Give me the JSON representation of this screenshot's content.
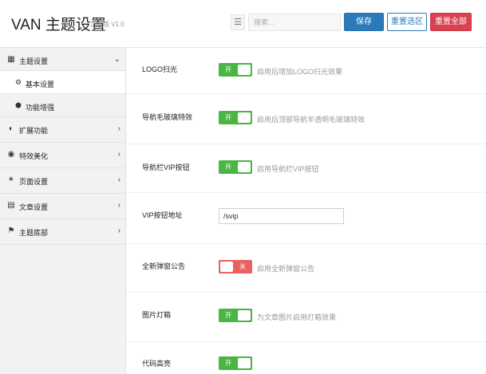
{
  "header": {
    "title": "VAN 主题设置",
    "subtitle": "正式版 V1.0",
    "menu_icon": "☰",
    "search_placeholder": "搜索...",
    "save_label": "保存",
    "reset_section_label": "重置选区",
    "reset_all_label": "重置全部"
  },
  "sidebar": {
    "items": [
      {
        "label": "主题设置",
        "icon": "grid-icon",
        "glyph": "▦",
        "expanded": true
      },
      {
        "label": "扩展功能",
        "icon": "circle-notch-icon",
        "glyph": "◐",
        "arrow": "›"
      },
      {
        "label": "特效美化",
        "icon": "palette-icon",
        "glyph": "◉",
        "arrow": "›"
      },
      {
        "label": "页面设置",
        "icon": "star-icon",
        "glyph": "✴",
        "arrow": "›"
      },
      {
        "label": "文章设置",
        "icon": "file-icon",
        "glyph": "▤",
        "arrow": "›"
      },
      {
        "label": "主题底部",
        "icon": "bookmark-icon",
        "glyph": "⚑",
        "arrow": "›"
      }
    ],
    "expanded_arrow": "⌄",
    "sub_items": [
      {
        "label": "基本设置",
        "icon": "gear-icon",
        "glyph": "⚙",
        "active": true
      },
      {
        "label": "功能增强",
        "icon": "cube-icon",
        "glyph": "⬢",
        "active": false
      }
    ]
  },
  "settings": {
    "on_text": "开",
    "off_text": "关",
    "rows": [
      {
        "label": "LOGO扫光",
        "state": "on",
        "desc": "启用后增加LOGO扫光效果"
      },
      {
        "label": "导航毛玻璃特效",
        "state": "on",
        "desc": "启用后顶部导航半透明毛玻璃特效"
      },
      {
        "label": "导航栏VIP按钮",
        "state": "on",
        "desc": "启用导航栏VIP按钮"
      },
      {
        "label": "VIP按钮地址",
        "type": "input",
        "value": "/svip"
      },
      {
        "label": "全新弹窗公告",
        "state": "off",
        "desc": "启用全新弹窗公告"
      },
      {
        "label": "图片灯箱",
        "state": "on",
        "desc": "为文章图片启用灯箱效果"
      },
      {
        "label": "代码高亮",
        "state": "on",
        "desc": ""
      }
    ]
  },
  "colors": {
    "primary": "#2c7bb8",
    "danger": "#d9414e",
    "switch_on": "#4bb544",
    "switch_off": "#e96161"
  }
}
